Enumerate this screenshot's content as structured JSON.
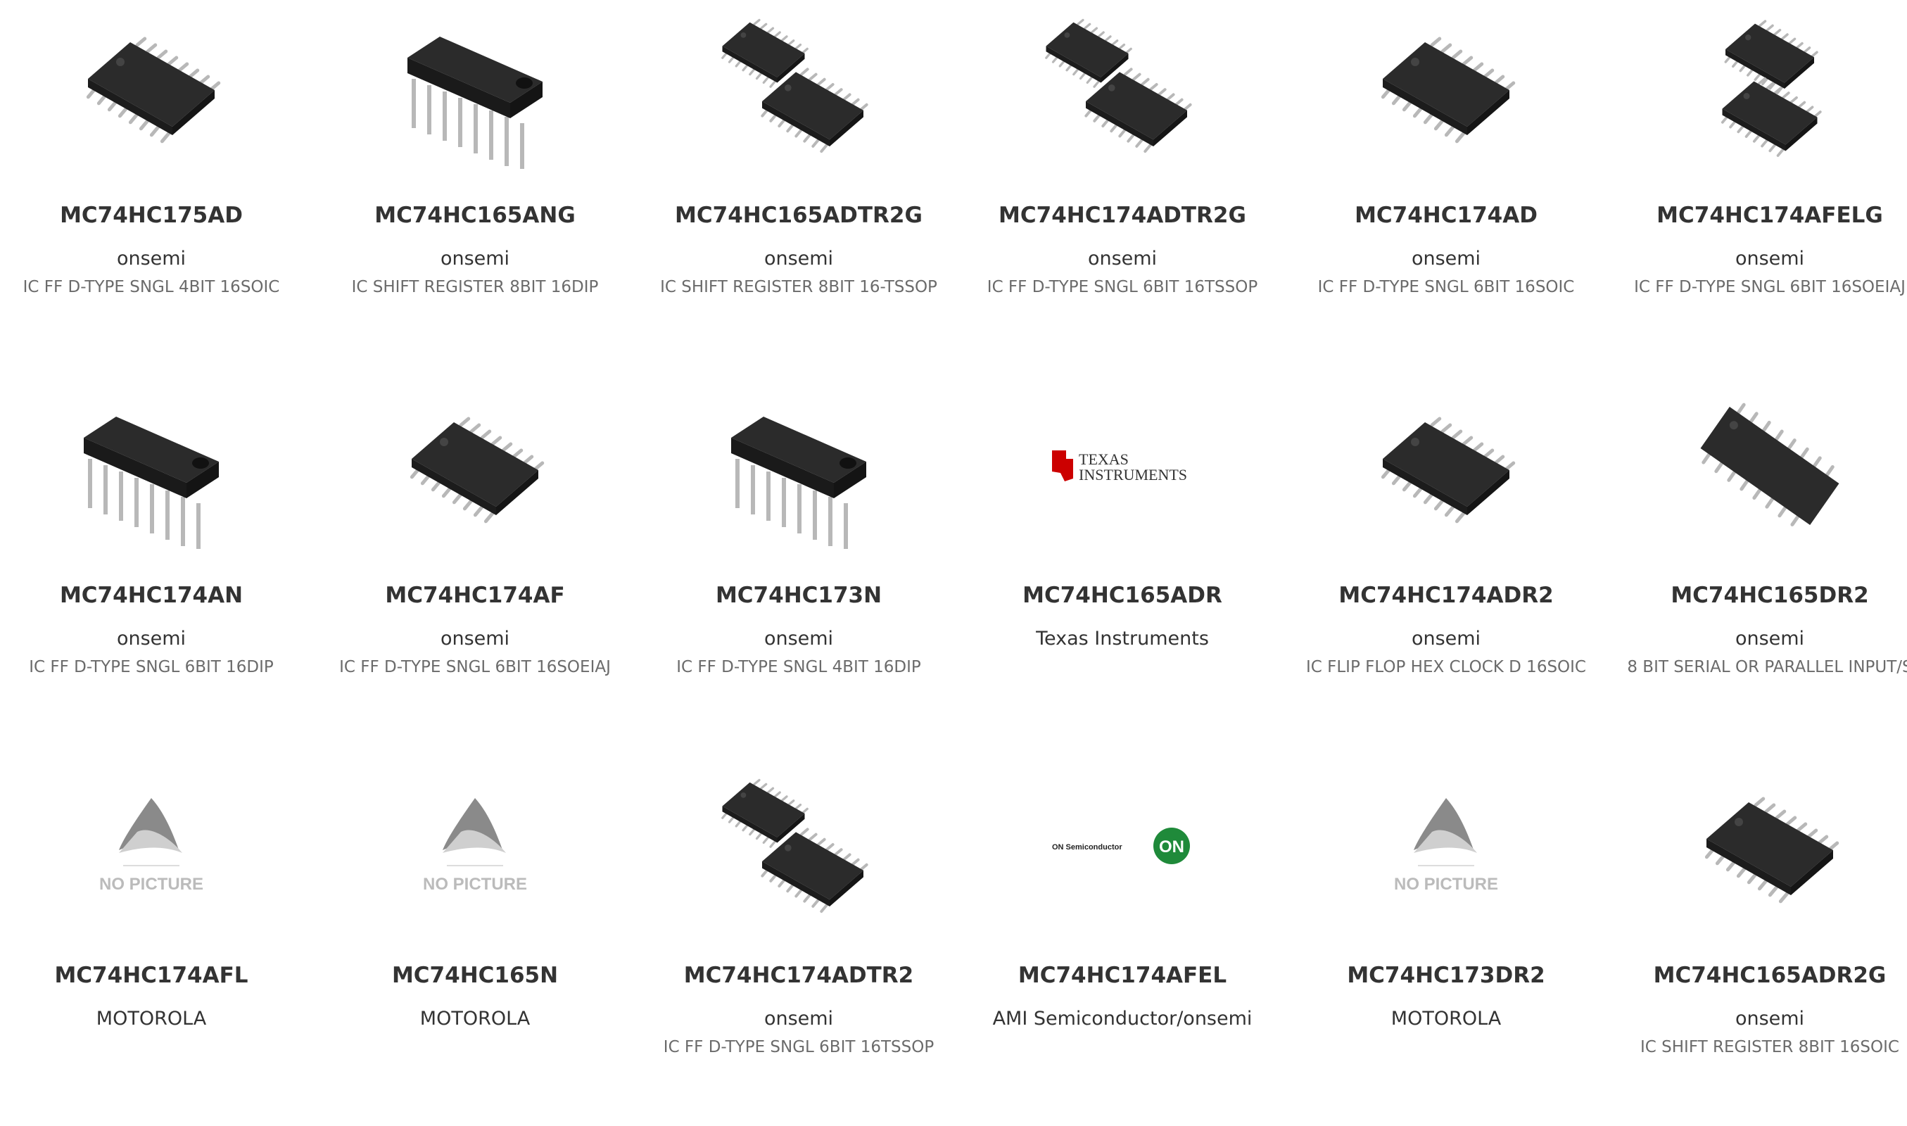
{
  "products": [
    {
      "part": "MC74HC175AD",
      "manufacturer": "onsemi",
      "description": "IC FF D-TYPE SNGL 4BIT 16SOIC",
      "image": "soic-chip"
    },
    {
      "part": "MC74HC165ANG",
      "manufacturer": "onsemi",
      "description": "IC SHIFT REGISTER 8BIT 16DIP",
      "image": "dip-chip"
    },
    {
      "part": "MC74HC165ADTR2G",
      "manufacturer": "onsemi",
      "description": "IC SHIFT REGISTER 8BIT 16-TSSOP",
      "image": "tssop-pair"
    },
    {
      "part": "MC74HC174ADTR2G",
      "manufacturer": "onsemi",
      "description": "IC FF D-TYPE SNGL 6BIT 16TSSOP",
      "image": "tssop-pair"
    },
    {
      "part": "MC74HC174AD",
      "manufacturer": "onsemi",
      "description": "IC FF D-TYPE SNGL 6BIT 16SOIC",
      "image": "soic-chip"
    },
    {
      "part": "MC74HC174AFELG",
      "manufacturer": "onsemi",
      "description": "IC FF D-TYPE SNGL 6BIT 16SOEIAJ",
      "image": "soic-pair"
    },
    {
      "part": "MC74HC174AN",
      "manufacturer": "onsemi",
      "description": "IC FF D-TYPE SNGL 6BIT 16DIP",
      "image": "dip-chip"
    },
    {
      "part": "MC74HC174AF",
      "manufacturer": "onsemi",
      "description": "IC FF D-TYPE SNGL 6BIT 16SOEIAJ",
      "image": "soic-chip"
    },
    {
      "part": "MC74HC173N",
      "manufacturer": "onsemi",
      "description": "IC FF D-TYPE SNGL 4BIT 16DIP",
      "image": "dip-chip"
    },
    {
      "part": "MC74HC165ADR",
      "manufacturer": "Texas Instruments",
      "description": "",
      "image": "ti-logo",
      "logo_text_1": "Texas",
      "logo_text_2": "Instruments"
    },
    {
      "part": "MC74HC174ADR2",
      "manufacturer": "onsemi",
      "description": "IC FLIP FLOP HEX CLOCK D 16SOIC",
      "image": "soic-chip"
    },
    {
      "part": "MC74HC165DR2",
      "manufacturer": "onsemi",
      "description": "8 BIT SERIAL OR PARALLEL INPUT/S",
      "image": "soic-tilted"
    },
    {
      "part": "MC74HC174AFL",
      "manufacturer": "MOTOROLA",
      "description": "",
      "image": "no-picture",
      "placeholder_text": "NO PICTURE"
    },
    {
      "part": "MC74HC165N",
      "manufacturer": "MOTOROLA",
      "description": "",
      "image": "no-picture",
      "placeholder_text": "NO PICTURE"
    },
    {
      "part": "MC74HC174ADTR2",
      "manufacturer": "onsemi",
      "description": "IC FF D-TYPE SNGL 6BIT 16TSSOP",
      "image": "tssop-pair"
    },
    {
      "part": "MC74HC174AFEL",
      "manufacturer": "AMI Semiconductor/onsemi",
      "description": "",
      "image": "on-logo",
      "logo_text_1": "ON Semiconductor",
      "logo_text_2": "ON"
    },
    {
      "part": "MC74HC173DR2",
      "manufacturer": "MOTOROLA",
      "description": "",
      "image": "no-picture",
      "placeholder_text": "NO PICTURE"
    },
    {
      "part": "MC74HC165ADR2G",
      "manufacturer": "onsemi",
      "description": "IC SHIFT REGISTER 8BIT 16SOIC",
      "image": "soic-chip"
    }
  ],
  "colors": {
    "part_text": "#333333",
    "description_text": "#6b6b6b",
    "chip_body": "#2b2b2b",
    "chip_pins": "#b8b8b8",
    "ti_red": "#cc0000",
    "on_green": "#1f8a3a"
  }
}
